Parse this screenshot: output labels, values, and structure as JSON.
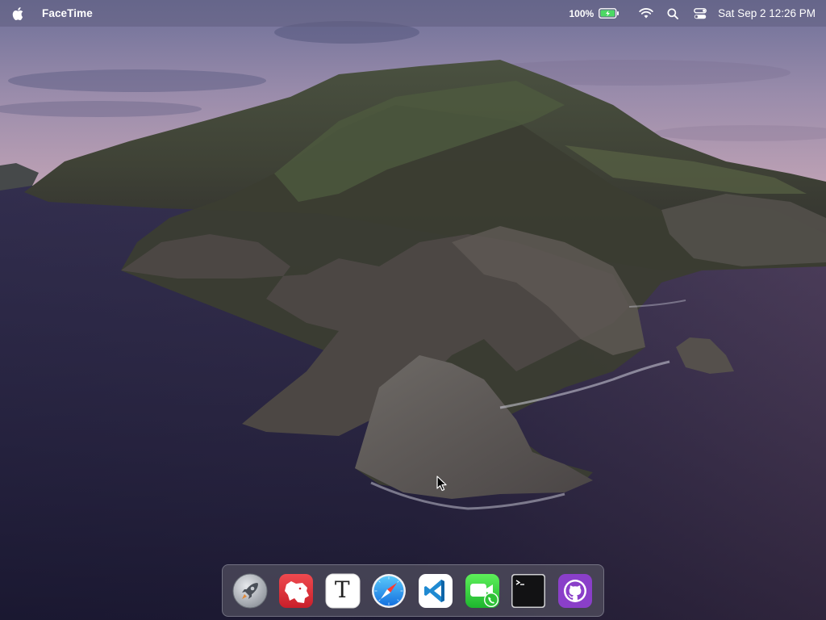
{
  "menubar": {
    "app_name": "FaceTime",
    "battery_percent": "100%",
    "clock": "Sat Sep 2  12:26 PM",
    "icons": [
      "apple-icon",
      "battery-charging-icon",
      "wifi-icon",
      "search-icon",
      "control-center-icon"
    ]
  },
  "dock": {
    "items": [
      {
        "name": "Launchpad",
        "icon": "rocket-icon"
      },
      {
        "name": "Bear",
        "icon": "bear-icon"
      },
      {
        "name": "Typora",
        "icon": "typora-icon",
        "glyph": "T"
      },
      {
        "name": "Safari",
        "icon": "compass-icon"
      },
      {
        "name": "Visual Studio Code",
        "icon": "vscode-icon"
      },
      {
        "name": "FaceTime",
        "icon": "facetime-icon"
      },
      {
        "name": "Terminal",
        "icon": "terminal-icon"
      },
      {
        "name": "GitHub Desktop",
        "icon": "github-icon"
      }
    ]
  },
  "colors": {
    "menubar_bg": "#605e80",
    "dock_bg": "#5c5a68",
    "text": "#ffffff",
    "battery_green": "#4cd964"
  }
}
